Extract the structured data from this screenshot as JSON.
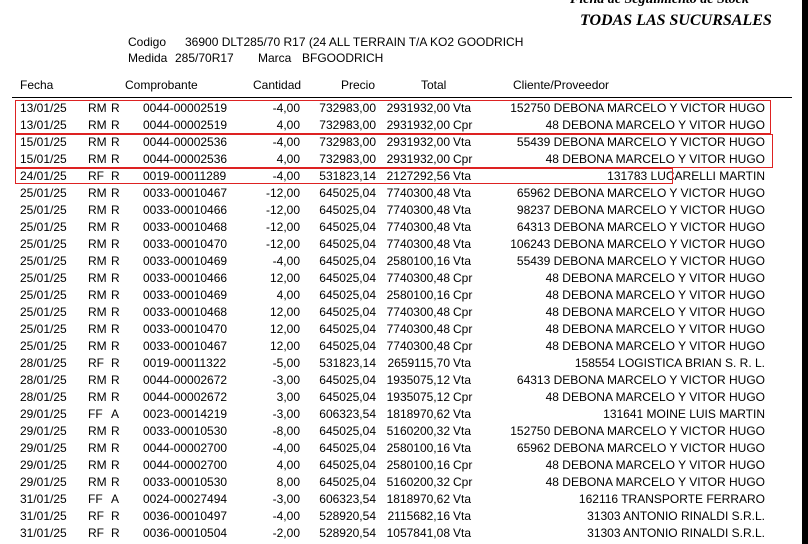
{
  "report": {
    "title": "Ficha de Seguimiento de Stock",
    "subtitle": "TODAS LAS SUCURSALES"
  },
  "product": {
    "codigo_label": "Codigo",
    "codigo_value": "36900 DLT285/70 R17 (24  ALL TERRAIN T/A KO2 GOODRICH",
    "medida_label": "Medida",
    "medida_value": "285/70R17",
    "marca_label": "Marca",
    "marca_value": "BFGOODRICH"
  },
  "columns": {
    "fecha": "Fecha",
    "comprobante": "Comprobante",
    "cantidad": "Cantidad",
    "precio": "Precio",
    "total": "Total",
    "cliente": "Cliente/Proveedor"
  },
  "rows": [
    {
      "fecha": "13/01/25",
      "tipo": "RM",
      "letra": "R",
      "comp": "0044-00002519",
      "cant": "-4,00",
      "precio": "732983,00",
      "total": "2931932,00",
      "mov": "Vta",
      "cliente": "152750 DEBONA MARCELO Y VICTOR HUGO"
    },
    {
      "fecha": "13/01/25",
      "tipo": "RM",
      "letra": "R",
      "comp": "0044-00002519",
      "cant": "4,00",
      "precio": "732983,00",
      "total": "2931932,00",
      "mov": "Cpr",
      "cliente": "48 DEBONA MARCELO Y VITOR HUGO"
    },
    {
      "fecha": "15/01/25",
      "tipo": "RM",
      "letra": "R",
      "comp": "0044-00002536",
      "cant": "-4,00",
      "precio": "732983,00",
      "total": "2931932,00",
      "mov": "Vta",
      "cliente": "55439 DEBONA MARCELO  Y VICTOR HUGO"
    },
    {
      "fecha": "15/01/25",
      "tipo": "RM",
      "letra": "R",
      "comp": "0044-00002536",
      "cant": "4,00",
      "precio": "732983,00",
      "total": "2931932,00",
      "mov": "Cpr",
      "cliente": "48 DEBONA MARCELO Y VITOR HUGO"
    },
    {
      "fecha": "24/01/25",
      "tipo": "RF",
      "letra": "R",
      "comp": "0019-00011289",
      "cant": "-4,00",
      "precio": "531823,14",
      "total": "2127292,56",
      "mov": "Vta",
      "cliente": "131783 LUCARELLI MARTIN"
    },
    {
      "fecha": "25/01/25",
      "tipo": "RM",
      "letra": "R",
      "comp": "0033-00010467",
      "cant": "-12,00",
      "precio": "645025,04",
      "total": "7740300,48",
      "mov": "Vta",
      "cliente": "65962 DEBONA MARCELO Y VICTOR HUGO"
    },
    {
      "fecha": "25/01/25",
      "tipo": "RM",
      "letra": "R",
      "comp": "0033-00010466",
      "cant": "-12,00",
      "precio": "645025,04",
      "total": "7740300,48",
      "mov": "Vta",
      "cliente": "98237 DEBONA MARCELO Y VICTOR HUGO"
    },
    {
      "fecha": "25/01/25",
      "tipo": "RM",
      "letra": "R",
      "comp": "0033-00010468",
      "cant": "-12,00",
      "precio": "645025,04",
      "total": "7740300,48",
      "mov": "Vta",
      "cliente": "64313 DEBONA MARCELO Y VICTOR HUGO"
    },
    {
      "fecha": "25/01/25",
      "tipo": "RM",
      "letra": "R",
      "comp": "0033-00010470",
      "cant": "-12,00",
      "precio": "645025,04",
      "total": "7740300,48",
      "mov": "Vta",
      "cliente": "106243 DEBONA MARCELO Y VICTOR HUGO"
    },
    {
      "fecha": "25/01/25",
      "tipo": "RM",
      "letra": "R",
      "comp": "0033-00010469",
      "cant": "-4,00",
      "precio": "645025,04",
      "total": "2580100,16",
      "mov": "Vta",
      "cliente": "55439 DEBONA MARCELO  Y VICTOR HUGO"
    },
    {
      "fecha": "25/01/25",
      "tipo": "RM",
      "letra": "R",
      "comp": "0033-00010466",
      "cant": "12,00",
      "precio": "645025,04",
      "total": "7740300,48",
      "mov": "Cpr",
      "cliente": "48 DEBONA MARCELO Y VITOR HUGO"
    },
    {
      "fecha": "25/01/25",
      "tipo": "RM",
      "letra": "R",
      "comp": "0033-00010469",
      "cant": "4,00",
      "precio": "645025,04",
      "total": "2580100,16",
      "mov": "Cpr",
      "cliente": "48 DEBONA MARCELO Y VITOR HUGO"
    },
    {
      "fecha": "25/01/25",
      "tipo": "RM",
      "letra": "R",
      "comp": "0033-00010468",
      "cant": "12,00",
      "precio": "645025,04",
      "total": "7740300,48",
      "mov": "Cpr",
      "cliente": "48 DEBONA MARCELO Y VITOR HUGO"
    },
    {
      "fecha": "25/01/25",
      "tipo": "RM",
      "letra": "R",
      "comp": "0033-00010470",
      "cant": "12,00",
      "precio": "645025,04",
      "total": "7740300,48",
      "mov": "Cpr",
      "cliente": "48 DEBONA MARCELO Y VITOR HUGO"
    },
    {
      "fecha": "25/01/25",
      "tipo": "RM",
      "letra": "R",
      "comp": "0033-00010467",
      "cant": "12,00",
      "precio": "645025,04",
      "total": "7740300,48",
      "mov": "Cpr",
      "cliente": "48 DEBONA MARCELO Y VITOR HUGO"
    },
    {
      "fecha": "28/01/25",
      "tipo": "RF",
      "letra": "R",
      "comp": "0019-00011322",
      "cant": "-5,00",
      "precio": "531823,14",
      "total": "2659115,70",
      "mov": "Vta",
      "cliente": "158554 LOGISTICA BRIAN S. R. L."
    },
    {
      "fecha": "28/01/25",
      "tipo": "RM",
      "letra": "R",
      "comp": "0044-00002672",
      "cant": "-3,00",
      "precio": "645025,04",
      "total": "1935075,12",
      "mov": "Vta",
      "cliente": "64313 DEBONA MARCELO Y VICTOR HUGO"
    },
    {
      "fecha": "28/01/25",
      "tipo": "RM",
      "letra": "R",
      "comp": "0044-00002672",
      "cant": "3,00",
      "precio": "645025,04",
      "total": "1935075,12",
      "mov": "Cpr",
      "cliente": "48 DEBONA MARCELO Y VITOR HUGO"
    },
    {
      "fecha": "29/01/25",
      "tipo": "FF",
      "letra": "A",
      "comp": "0023-00014219",
      "cant": "-3,00",
      "precio": "606323,54",
      "total": "1818970,62",
      "mov": "Vta",
      "cliente": "131641 MOINE LUIS MARTIN"
    },
    {
      "fecha": "29/01/25",
      "tipo": "RM",
      "letra": "R",
      "comp": "0033-00010530",
      "cant": "-8,00",
      "precio": "645025,04",
      "total": "5160200,32",
      "mov": "Vta",
      "cliente": "152750 DEBONA MARCELO Y VICTOR HUGO"
    },
    {
      "fecha": "29/01/25",
      "tipo": "RM",
      "letra": "R",
      "comp": "0044-00002700",
      "cant": "-4,00",
      "precio": "645025,04",
      "total": "2580100,16",
      "mov": "Vta",
      "cliente": "65962 DEBONA MARCELO Y VICTOR HUGO"
    },
    {
      "fecha": "29/01/25",
      "tipo": "RM",
      "letra": "R",
      "comp": "0044-00002700",
      "cant": "4,00",
      "precio": "645025,04",
      "total": "2580100,16",
      "mov": "Cpr",
      "cliente": "48 DEBONA MARCELO Y VITOR HUGO"
    },
    {
      "fecha": "29/01/25",
      "tipo": "RM",
      "letra": "R",
      "comp": "0033-00010530",
      "cant": "8,00",
      "precio": "645025,04",
      "total": "5160200,32",
      "mov": "Cpr",
      "cliente": "48 DEBONA MARCELO Y VITOR HUGO"
    },
    {
      "fecha": "31/01/25",
      "tipo": "FF",
      "letra": "A",
      "comp": "0024-00027494",
      "cant": "-3,00",
      "precio": "606323,54",
      "total": "1818970,62",
      "mov": "Vta",
      "cliente": "162116 TRANSPORTE FERRARO"
    },
    {
      "fecha": "31/01/25",
      "tipo": "RF",
      "letra": "R",
      "comp": "0036-00010497",
      "cant": "-4,00",
      "precio": "528920,54",
      "total": "2115682,16",
      "mov": "Vta",
      "cliente": "31303 ANTONIO RINALDI S.R.L."
    },
    {
      "fecha": "31/01/25",
      "tipo": "RF",
      "letra": "R",
      "comp": "0036-00010504",
      "cant": "-2,00",
      "precio": "528920,54",
      "total": "1057841,08",
      "mov": "Vta",
      "cliente": "31303 ANTONIO RINALDI S.R.L."
    }
  ],
  "highlight_color": "#dd2222"
}
